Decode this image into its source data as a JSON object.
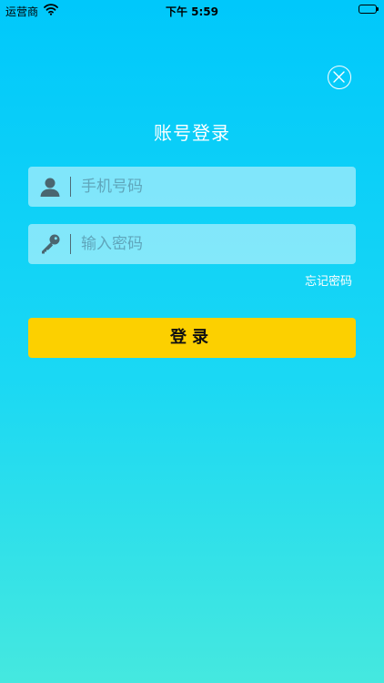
{
  "status_bar": {
    "carrier": "运营商",
    "time": "下午 5:59"
  },
  "login": {
    "title": "账号登录",
    "phone": {
      "placeholder": "手机号码",
      "value": ""
    },
    "password": {
      "placeholder": "输入密码",
      "value": ""
    },
    "forgot_label": "忘记密码",
    "submit_label": "登录"
  },
  "colors": {
    "background_top": "#00c8fb",
    "background_bottom": "#45e8df",
    "button": "#fcd000",
    "icon": "#4a6670"
  },
  "icons": {
    "close": "close-circle-icon",
    "user": "user-icon",
    "key": "key-icon",
    "wifi": "wifi-icon",
    "battery": "battery-icon"
  }
}
